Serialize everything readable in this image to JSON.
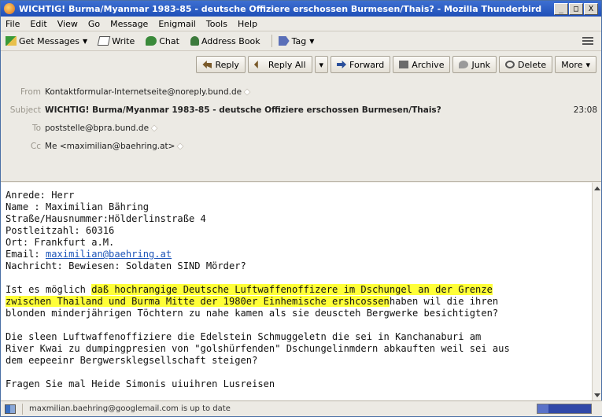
{
  "window": {
    "title": "WICHTIG! Burma/Myanmar 1983-85 - deutsche Offiziere erschossen Burmesen/Thais? - Mozilla Thunderbird",
    "minimize": "_",
    "maximize": "□",
    "close": "X"
  },
  "menu": [
    "File",
    "Edit",
    "View",
    "Go",
    "Message",
    "Enigmail",
    "Tools",
    "Help"
  ],
  "toolbar": {
    "get_messages": "Get Messages",
    "write": "Write",
    "chat": "Chat",
    "address_book": "Address Book",
    "tag": "Tag"
  },
  "actions": {
    "reply": "Reply",
    "reply_all": "Reply All",
    "forward": "Forward",
    "archive": "Archive",
    "junk": "Junk",
    "delete": "Delete",
    "more": "More"
  },
  "header": {
    "from_label": "From",
    "from_value": "Kontaktformular-Internetseite@noreply.bund.de",
    "subject_label": "Subject",
    "subject_value": "WICHTIG! Burma/Myanmar 1983-85 - deutsche Offiziere erschossen Burmesen/Thais?",
    "time": "23:08",
    "to_label": "To",
    "to_value": "poststelle@bpra.bund.de",
    "cc_label": "Cc",
    "cc_value": "Me <maximilian@baehring.at>"
  },
  "body": {
    "line1": "Anrede: Herr",
    "line2": "Name : Maximilian Bähring",
    "line3": "Straße/Hausnummer:Hölderlinstraße 4",
    "line4": "Postleitzahl: 60316",
    "line5": "Ort: Frankfurt a.M.",
    "email_label": "Email: ",
    "email_link": "maximilian@baehring.at",
    "line7": "Nachricht: Bewiesen: Soldaten SIND Mörder?",
    "p2_a": "Ist es möglich ",
    "p2_hl1": "daß hochrangige Deutsche Luftwaffenoffizere im Dschungel an der Grenze",
    "p2_hl2": "zwischen Thailand und Burma Mitte der 1980er Einhemische ershcossen",
    "p2_b": "haben wil die ihren",
    "p2_c": "blonden minderjährigen Töchtern zu nahe kamen als sie deuscteh Bergwerke besichtigten?",
    "p3_a": "Die sleen Luftwaffenoffiziere die Edelstein Schmuggeletn die sei in Kanchanaburi am",
    "p3_b": "River Kwai zu dumpingpresien von \"golshürfenden\" Dschungelinmdern abkauften weil sei aus",
    "p3_c": "dem eepeeinr Bergwersklegsellschaft steigen?",
    "p4": "Fragen Sie mal Heide Simonis uiuihren Lusreisen"
  },
  "status": {
    "text": "maxmilian.baehring@googlemail.com is up to date",
    "progress": 0.2
  }
}
